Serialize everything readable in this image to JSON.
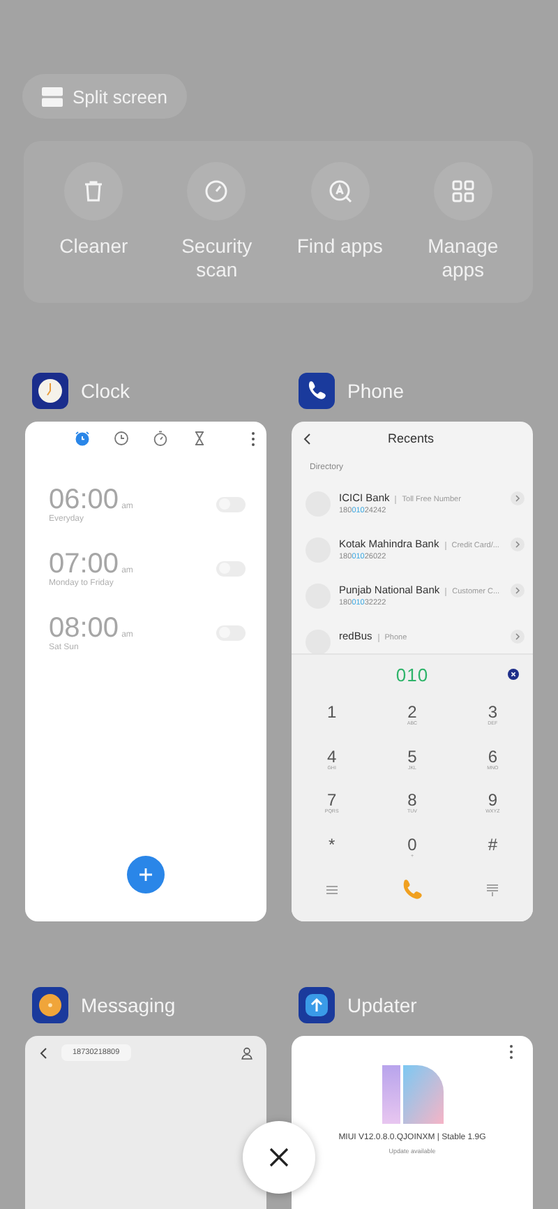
{
  "split_screen": {
    "label": "Split screen"
  },
  "quick_tools": [
    {
      "kind": "cleaner",
      "label": "Cleaner"
    },
    {
      "kind": "security",
      "label": "Security scan"
    },
    {
      "kind": "find",
      "label": "Find apps"
    },
    {
      "kind": "manage",
      "label": "Manage apps"
    }
  ],
  "apps": [
    {
      "kind": "clock",
      "title": "Clock",
      "tabs": [
        {
          "kind": "alarm",
          "selected": true
        },
        {
          "kind": "clock",
          "selected": false
        },
        {
          "kind": "stopwatch",
          "selected": false
        },
        {
          "kind": "timer",
          "selected": false
        }
      ],
      "alarms": [
        {
          "time": "06:00",
          "period": "am",
          "repeat": "Everyday",
          "on": false
        },
        {
          "time": "07:00",
          "period": "am",
          "repeat": "Monday to Friday",
          "on": false
        },
        {
          "time": "08:00",
          "period": "am",
          "repeat": "Sat Sun",
          "on": false
        }
      ]
    },
    {
      "kind": "phone",
      "title": "Phone",
      "header": "Recents",
      "section": "Directory",
      "entries": [
        {
          "name": "ICICI Bank",
          "tag": "Toll Free Number",
          "number": [
            "180",
            "010",
            "24242"
          ]
        },
        {
          "name": "Kotak Mahindra Bank",
          "tag": "Credit Card/...",
          "number": [
            "180",
            "010",
            "26022"
          ]
        },
        {
          "name": "Punjab National Bank",
          "tag": "Customer C...",
          "number": [
            "180",
            "010",
            "32222"
          ]
        },
        {
          "name": "redBus",
          "tag": "Phone"
        }
      ],
      "dialed": "010",
      "keys": [
        {
          "digit": "1"
        },
        {
          "digit": "2",
          "letters": "ABC"
        },
        {
          "digit": "3",
          "letters": "DEF"
        },
        {
          "digit": "4",
          "letters": "GHI"
        },
        {
          "digit": "5",
          "letters": "JKL"
        },
        {
          "digit": "6",
          "letters": "MNO"
        },
        {
          "digit": "7",
          "letters": "PQRS"
        },
        {
          "digit": "8",
          "letters": "TUV"
        },
        {
          "digit": "9",
          "letters": "WXYZ"
        },
        {
          "digit": "*"
        },
        {
          "digit": "0",
          "letters": "+"
        },
        {
          "digit": "#"
        }
      ]
    },
    {
      "kind": "messaging",
      "title": "Messaging",
      "contact": "18730218809"
    },
    {
      "kind": "updater",
      "title": "Updater",
      "version": "MIUI V12.0.8.0.QJOINXM | Stable 1.9G",
      "status": "Update available"
    }
  ]
}
